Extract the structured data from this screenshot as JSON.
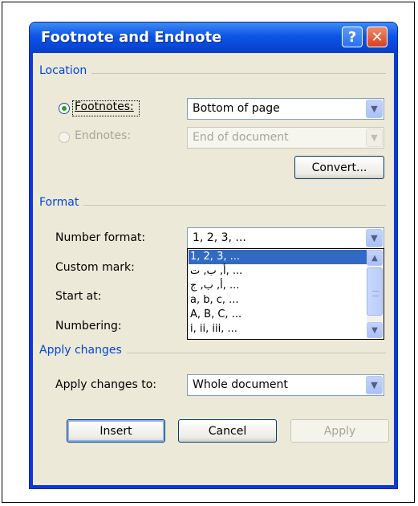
{
  "dialog": {
    "title": "Footnote and Endnote",
    "help_glyph": "?",
    "close_glyph": "✕"
  },
  "location": {
    "group_label": "Location",
    "footnotes_label": "Footnotes:",
    "footnotes_value": "Bottom of page",
    "footnotes_selected": true,
    "endnotes_label": "Endnotes:",
    "endnotes_value": "End of document",
    "endnotes_selected": false,
    "convert_label": "Convert..."
  },
  "format": {
    "group_label": "Format",
    "number_format_label": "Number format:",
    "number_format_value": "1, 2, 3, ...",
    "custom_mark_label": "Custom mark:",
    "start_at_label": "Start at:",
    "numbering_label": "Numbering:",
    "options": [
      "1, 2, 3, ...",
      "أ, ب, ت, ...",
      "أ, ب, ج, ...",
      "a, b, c, ...",
      "A, B, C, ...",
      "i, ii, iii, ..."
    ]
  },
  "apply": {
    "group_label": "Apply changes",
    "apply_to_label": "Apply changes to:",
    "apply_to_value": "Whole document"
  },
  "buttons": {
    "insert": "Insert",
    "cancel": "Cancel",
    "apply": "Apply"
  },
  "icons": {
    "dropdown": "chevron-down-icon",
    "scroll_up": "scroll-up-icon",
    "scroll_down": "scroll-down-icon",
    "help": "help-icon",
    "close": "close-icon"
  },
  "colors": {
    "title_blue": "#0b55e4",
    "group_label_blue": "#0046d5",
    "selection": "#316ac5",
    "close_red": "#d6401f",
    "dialog_face": "#ece9d8"
  }
}
